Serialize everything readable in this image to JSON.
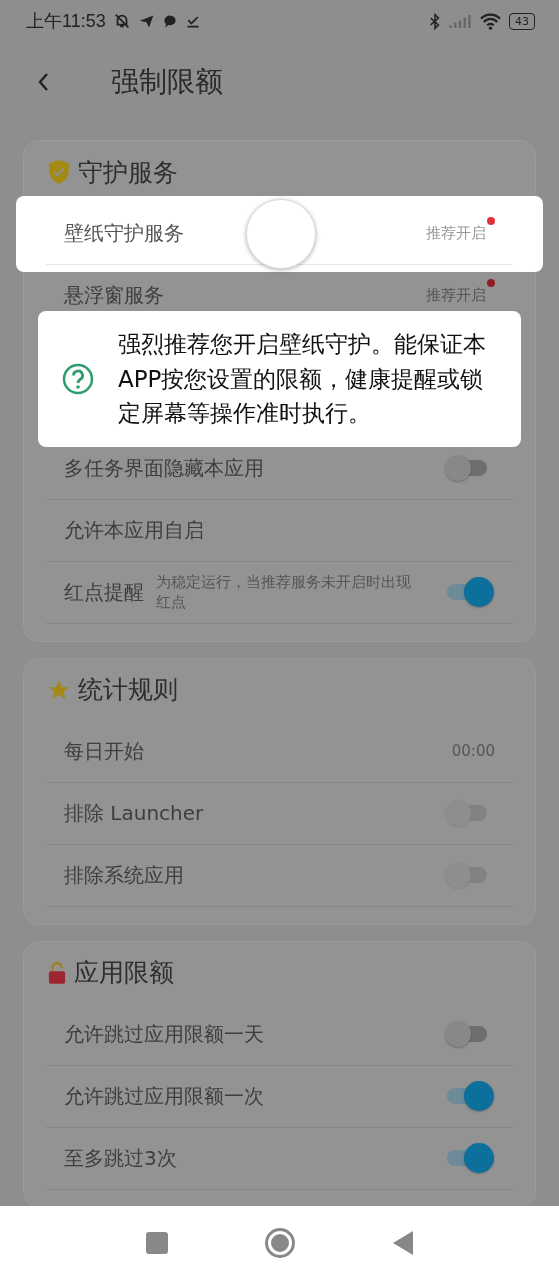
{
  "status_bar": {
    "time": "上午11:53",
    "battery": "43"
  },
  "header": {
    "title": "强制限额"
  },
  "sections": [
    {
      "title": "守护服务",
      "rows": [
        {
          "label": "壁纸守护服务",
          "kind": "value",
          "value": "推荐开启",
          "alert": true,
          "highlighted": true
        },
        {
          "label": "悬浮窗服务",
          "kind": "value",
          "value": "推荐开启",
          "alert": true,
          "highlighted": false
        },
        {
          "kind": "tooltip",
          "text": "强烈推荐您开启壁纸守护。能保证本APP按您设置的限额，健康提醒或锁定屏幕等操作准时执行。"
        },
        {
          "label": "多任务界面隐藏本应用",
          "kind": "toggle",
          "on": false,
          "disabled": false
        },
        {
          "label": "允许本应用自启",
          "kind": "plain"
        },
        {
          "label": "红点提醒",
          "kind": "toggle",
          "note": "为稳定运行，当推荐服务未开启时出现红点",
          "on": true,
          "disabled": false
        }
      ]
    },
    {
      "title": "统计规则",
      "rows": [
        {
          "label": "每日开始",
          "kind": "value",
          "value": "00:00",
          "alert": false,
          "highlighted": false
        },
        {
          "label": "排除 Launcher",
          "kind": "toggle",
          "on": false,
          "disabled": true
        },
        {
          "label": "排除系统应用",
          "kind": "toggle",
          "on": false,
          "disabled": true
        }
      ]
    },
    {
      "title": "应用限额",
      "rows": [
        {
          "label": "允许跳过应用限额一天",
          "kind": "toggle",
          "on": false,
          "disabled": false
        },
        {
          "label": "允许跳过应用限额一次",
          "kind": "toggle",
          "on": true,
          "disabled": false
        },
        {
          "label": "至多跳过3次",
          "kind": "toggle",
          "on": true,
          "disabled": false
        }
      ]
    }
  ]
}
